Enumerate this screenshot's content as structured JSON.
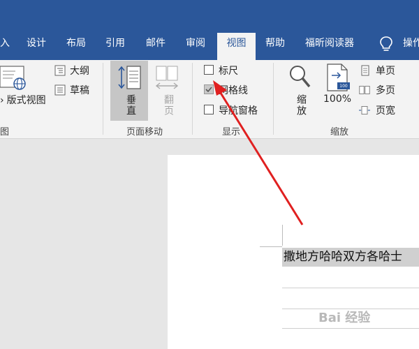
{
  "tabs": [
    {
      "id": "insert",
      "label": "入"
    },
    {
      "id": "design",
      "label": "设计"
    },
    {
      "id": "layout",
      "label": "布局"
    },
    {
      "id": "references",
      "label": "引用"
    },
    {
      "id": "mailings",
      "label": "邮件"
    },
    {
      "id": "review",
      "label": "审阅"
    },
    {
      "id": "view",
      "label": "视图",
      "active": true
    },
    {
      "id": "help",
      "label": "帮助"
    },
    {
      "id": "foxit",
      "label": "福昕阅读器"
    }
  ],
  "tell_me": {
    "icon": "lightbulb-icon",
    "label": "操作"
  },
  "ribbon": {
    "views": {
      "print_layout": "版式视图",
      "outline": "大纲",
      "draft": "草稿",
      "group_label": "图"
    },
    "page_movement": {
      "vertical": "垂直",
      "side_to_side": "翻页",
      "group_label": "页面移动"
    },
    "show": {
      "ruler": {
        "label": "标尺",
        "checked": false
      },
      "gridlines": {
        "label": "网格线",
        "checked": true
      },
      "navigation_pane": {
        "label": "导航窗格",
        "checked": false
      },
      "group_label": "显示"
    },
    "zoom": {
      "zoom": "缩放",
      "hundred_percent": "100%",
      "hundred_badge": "100",
      "one_page": "单页",
      "multiple_pages": "多页",
      "page_width": "页宽",
      "group_label": "缩放"
    }
  },
  "document": {
    "line1": "撒地方哈哈双方各哈士"
  },
  "watermark": "Bai 经验",
  "colors": {
    "accent": "#2b579a",
    "annotation": "#e02020"
  }
}
